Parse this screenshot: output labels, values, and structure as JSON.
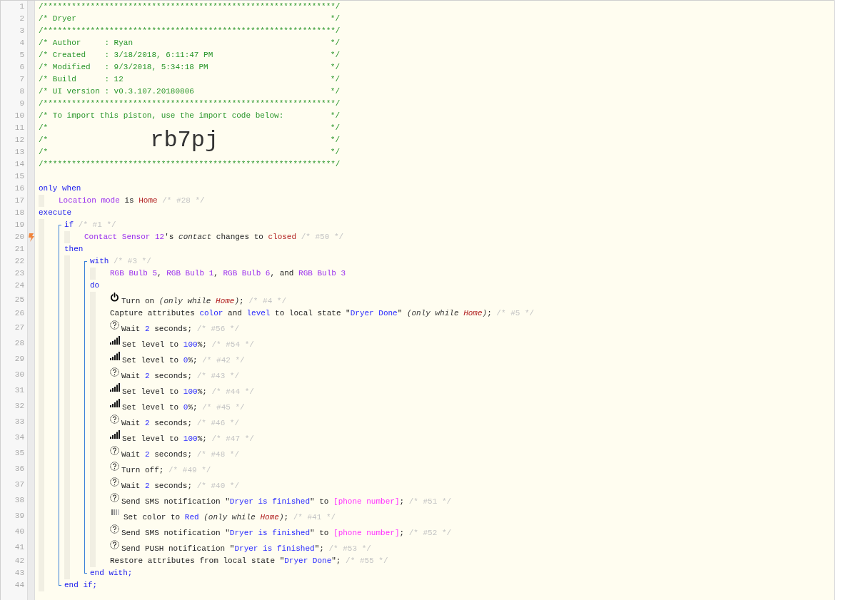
{
  "editor": {
    "lines": [
      {
        "kind": "line",
        "n": "1",
        "tokens": [
          {
            "kind": "h",
            "text": "/**************************************************************/"
          }
        ]
      },
      {
        "kind": "line",
        "n": "2",
        "tokens": [
          {
            "kind": "h",
            "text": "/* Dryer"
          },
          {
            "kind": "he",
            "text": "*/"
          }
        ]
      },
      {
        "kind": "line",
        "n": "3",
        "tokens": [
          {
            "kind": "h",
            "text": "/**************************************************************/"
          }
        ]
      },
      {
        "kind": "line",
        "n": "4",
        "tokens": [
          {
            "kind": "h",
            "text": "/* Author     : Ryan"
          },
          {
            "kind": "he",
            "text": "*/"
          }
        ]
      },
      {
        "kind": "line",
        "n": "5",
        "tokens": [
          {
            "kind": "h",
            "text": "/* Created    : 3/18/2018, 6:11:47 PM"
          },
          {
            "kind": "he",
            "text": "*/"
          }
        ]
      },
      {
        "kind": "line",
        "n": "6",
        "tokens": [
          {
            "kind": "h",
            "text": "/* Modified   : 9/3/2018, 5:34:18 PM"
          },
          {
            "kind": "he",
            "text": "*/"
          }
        ]
      },
      {
        "kind": "line",
        "n": "7",
        "tokens": [
          {
            "kind": "h",
            "text": "/* Build      : 12"
          },
          {
            "kind": "he",
            "text": "*/"
          }
        ]
      },
      {
        "kind": "line",
        "n": "8",
        "tokens": [
          {
            "kind": "h",
            "text": "/* UI version : v0.3.107.20180806"
          },
          {
            "kind": "he",
            "text": "*/"
          }
        ]
      },
      {
        "kind": "line",
        "n": "9",
        "tokens": [
          {
            "kind": "h",
            "text": "/**************************************************************/"
          }
        ]
      },
      {
        "kind": "line",
        "n": "10",
        "tokens": [
          {
            "kind": "h",
            "text": "/* To import this piston, use the import code below:"
          },
          {
            "kind": "he",
            "text": "*/"
          }
        ]
      },
      {
        "kind": "line",
        "n": "11",
        "tokens": [
          {
            "kind": "h",
            "text": "/*"
          },
          {
            "kind": "he",
            "text": "*/"
          }
        ]
      },
      {
        "kind": "line",
        "n": "12",
        "tokens": [
          {
            "kind": "h",
            "text": "/*"
          },
          {
            "kind": "code",
            "text": "rb7pj"
          },
          {
            "kind": "he",
            "text": "*/"
          }
        ]
      },
      {
        "kind": "line",
        "n": "13",
        "tokens": [
          {
            "kind": "h",
            "text": "/*"
          },
          {
            "kind": "he",
            "text": "*/"
          }
        ]
      },
      {
        "kind": "line",
        "n": "14",
        "tokens": [
          {
            "kind": "h",
            "text": "/**************************************************************/"
          }
        ]
      },
      {
        "kind": "line",
        "n": "15"
      },
      {
        "kind": "line",
        "n": "16",
        "tokens": [
          {
            "kind": "kw",
            "text": "only when"
          }
        ],
        "children": [
          {
            "kind": "line",
            "n": "17",
            "tokens": [
              {
                "kind": "dev",
                "text": "Location mode"
              },
              {
                "kind": "txt",
                "text": " is "
              },
              {
                "kind": "val",
                "text": "Home"
              },
              {
                "kind": "cmt",
                "text": " /* #28 */"
              }
            ]
          }
        ]
      },
      {
        "kind": "line",
        "n": "18",
        "tokens": [
          {
            "kind": "kw",
            "text": "execute"
          }
        ],
        "children": [
          {
            "kind": "block",
            "parts": [
              {
                "kind": "line",
                "n": "19",
                "tokens": [
                  {
                    "kind": "kw",
                    "text": "if"
                  },
                  {
                    "kind": "cmt",
                    "text": " /* #1 */"
                  }
                ],
                "children": [
                  {
                    "kind": "line",
                    "n": "20",
                    "trigger": true,
                    "tokens": [
                      {
                        "kind": "dev",
                        "text": "Contact Sensor 12"
                      },
                      {
                        "kind": "txt",
                        "text": "'s "
                      },
                      {
                        "kind": "it",
                        "text": "contact"
                      },
                      {
                        "kind": "txt",
                        "text": " changes to "
                      },
                      {
                        "kind": "val",
                        "text": "closed"
                      },
                      {
                        "kind": "cmt",
                        "text": " /* #50 */"
                      }
                    ]
                  }
                ]
              },
              {
                "kind": "line",
                "n": "21",
                "tokens": [
                  {
                    "kind": "kw",
                    "text": "then"
                  }
                ],
                "children": [
                  {
                    "kind": "block",
                    "parts": [
                      {
                        "kind": "line",
                        "n": "22",
                        "tokens": [
                          {
                            "kind": "kw",
                            "text": "with"
                          },
                          {
                            "kind": "cmt",
                            "text": " /* #3 */"
                          }
                        ],
                        "children": [
                          {
                            "kind": "line",
                            "n": "23",
                            "tokens": [
                              {
                                "kind": "dev",
                                "text": "RGB Bulb 5"
                              },
                              {
                                "kind": "txt",
                                "text": ", "
                              },
                              {
                                "kind": "dev",
                                "text": "RGB Bulb 1"
                              },
                              {
                                "kind": "txt",
                                "text": ", "
                              },
                              {
                                "kind": "dev",
                                "text": "RGB Bulb 6"
                              },
                              {
                                "kind": "txt",
                                "text": ", and "
                              },
                              {
                                "kind": "dev",
                                "text": "RGB Bulb 3"
                              }
                            ]
                          }
                        ]
                      },
                      {
                        "kind": "line",
                        "n": "24",
                        "tokens": [
                          {
                            "kind": "kw",
                            "text": "do"
                          }
                        ],
                        "children": [
                          {
                            "kind": "power",
                            "n": "25",
                            "tokens": [
                              {
                                "kind": "txt",
                                "text": "Turn on "
                              },
                              {
                                "kind": "it",
                                "text": "(only while "
                              },
                              {
                                "kind": "ival",
                                "text": "Home"
                              },
                              {
                                "kind": "it",
                                "text": ")"
                              },
                              {
                                "kind": "txt",
                                "text": "; "
                              },
                              {
                                "kind": "cmt",
                                "text": "/* #4 */"
                              }
                            ]
                          },
                          {
                            "kind": "line",
                            "n": "26",
                            "tokens": [
                              {
                                "kind": "txt",
                                "text": "Capture attributes "
                              },
                              {
                                "kind": "num",
                                "text": "color"
                              },
                              {
                                "kind": "txt",
                                "text": " and "
                              },
                              {
                                "kind": "num",
                                "text": "level"
                              },
                              {
                                "kind": "txt",
                                "text": " to local state \""
                              },
                              {
                                "kind": "num",
                                "text": "Dryer Done"
                              },
                              {
                                "kind": "txt",
                                "text": "\" "
                              },
                              {
                                "kind": "it",
                                "text": "(only while "
                              },
                              {
                                "kind": "ival",
                                "text": "Home"
                              },
                              {
                                "kind": "it",
                                "text": ")"
                              },
                              {
                                "kind": "txt",
                                "text": "; "
                              },
                              {
                                "kind": "cmt",
                                "text": "/* #5 */"
                              }
                            ]
                          },
                          {
                            "kind": "help",
                            "n": "27",
                            "tokens": [
                              {
                                "kind": "txt",
                                "text": "Wait "
                              },
                              {
                                "kind": "num",
                                "text": "2"
                              },
                              {
                                "kind": "txt",
                                "text": " seconds; "
                              },
                              {
                                "kind": "cmt",
                                "text": "/* #56 */"
                              }
                            ]
                          },
                          {
                            "kind": "level",
                            "n": "28",
                            "tokens": [
                              {
                                "kind": "txt",
                                "text": "Set level to "
                              },
                              {
                                "kind": "num",
                                "text": "100"
                              },
                              {
                                "kind": "txt",
                                "text": "%; "
                              },
                              {
                                "kind": "cmt",
                                "text": "/* #54 */"
                              }
                            ]
                          },
                          {
                            "kind": "level",
                            "n": "29",
                            "tokens": [
                              {
                                "kind": "txt",
                                "text": "Set level to "
                              },
                              {
                                "kind": "num",
                                "text": "0"
                              },
                              {
                                "kind": "txt",
                                "text": "%; "
                              },
                              {
                                "kind": "cmt",
                                "text": "/* #42 */"
                              }
                            ]
                          },
                          {
                            "kind": "help",
                            "n": "30",
                            "tokens": [
                              {
                                "kind": "txt",
                                "text": "Wait "
                              },
                              {
                                "kind": "num",
                                "text": "2"
                              },
                              {
                                "kind": "txt",
                                "text": " seconds; "
                              },
                              {
                                "kind": "cmt",
                                "text": "/* #43 */"
                              }
                            ]
                          },
                          {
                            "kind": "level",
                            "n": "31",
                            "tokens": [
                              {
                                "kind": "txt",
                                "text": "Set level to "
                              },
                              {
                                "kind": "num",
                                "text": "100"
                              },
                              {
                                "kind": "txt",
                                "text": "%; "
                              },
                              {
                                "kind": "cmt",
                                "text": "/* #44 */"
                              }
                            ]
                          },
                          {
                            "kind": "level",
                            "n": "32",
                            "tokens": [
                              {
                                "kind": "txt",
                                "text": "Set level to "
                              },
                              {
                                "kind": "num",
                                "text": "0"
                              },
                              {
                                "kind": "txt",
                                "text": "%; "
                              },
                              {
                                "kind": "cmt",
                                "text": "/* #45 */"
                              }
                            ]
                          },
                          {
                            "kind": "help",
                            "n": "33",
                            "tokens": [
                              {
                                "kind": "txt",
                                "text": "Wait "
                              },
                              {
                                "kind": "num",
                                "text": "2"
                              },
                              {
                                "kind": "txt",
                                "text": " seconds; "
                              },
                              {
                                "kind": "cmt",
                                "text": "/* #46 */"
                              }
                            ]
                          },
                          {
                            "kind": "level",
                            "n": "34",
                            "tokens": [
                              {
                                "kind": "txt",
                                "text": "Set level to "
                              },
                              {
                                "kind": "num",
                                "text": "100"
                              },
                              {
                                "kind": "txt",
                                "text": "%; "
                              },
                              {
                                "kind": "cmt",
                                "text": "/* #47 */"
                              }
                            ]
                          },
                          {
                            "kind": "help",
                            "n": "35",
                            "tokens": [
                              {
                                "kind": "txt",
                                "text": "Wait "
                              },
                              {
                                "kind": "num",
                                "text": "2"
                              },
                              {
                                "kind": "txt",
                                "text": " seconds; "
                              },
                              {
                                "kind": "cmt",
                                "text": "/* #48 */"
                              }
                            ]
                          },
                          {
                            "kind": "help",
                            "n": "36",
                            "tokens": [
                              {
                                "kind": "txt",
                                "text": "Turn off; "
                              },
                              {
                                "kind": "cmt",
                                "text": "/* #49 */"
                              }
                            ]
                          },
                          {
                            "kind": "help",
                            "n": "37",
                            "tokens": [
                              {
                                "kind": "txt",
                                "text": "Wait "
                              },
                              {
                                "kind": "num",
                                "text": "2"
                              },
                              {
                                "kind": "txt",
                                "text": " seconds; "
                              },
                              {
                                "kind": "cmt",
                                "text": "/* #40 */"
                              }
                            ]
                          },
                          {
                            "kind": "help",
                            "n": "38",
                            "tokens": [
                              {
                                "kind": "txt",
                                "text": "Send SMS notification \""
                              },
                              {
                                "kind": "num",
                                "text": "Dryer is finished"
                              },
                              {
                                "kind": "txt",
                                "text": "\" to "
                              },
                              {
                                "kind": "ph",
                                "text": "[phone number]"
                              },
                              {
                                "kind": "txt",
                                "text": "; "
                              },
                              {
                                "kind": "cmt",
                                "text": "/* #51 */"
                              }
                            ]
                          },
                          {
                            "kind": "color",
                            "n": "39",
                            "tokens": [
                              {
                                "kind": "txt",
                                "text": "Set color to "
                              },
                              {
                                "kind": "num",
                                "text": "Red"
                              },
                              {
                                "kind": "it",
                                "text": " (only while "
                              },
                              {
                                "kind": "ival",
                                "text": "Home"
                              },
                              {
                                "kind": "it",
                                "text": ")"
                              },
                              {
                                "kind": "txt",
                                "text": "; "
                              },
                              {
                                "kind": "cmt",
                                "text": "/* #41 */"
                              }
                            ]
                          },
                          {
                            "kind": "help",
                            "n": "40",
                            "tokens": [
                              {
                                "kind": "txt",
                                "text": "Send SMS notification \""
                              },
                              {
                                "kind": "num",
                                "text": "Dryer is finished"
                              },
                              {
                                "kind": "txt",
                                "text": "\" to "
                              },
                              {
                                "kind": "ph",
                                "text": "[phone number]"
                              },
                              {
                                "kind": "txt",
                                "text": "; "
                              },
                              {
                                "kind": "cmt",
                                "text": "/* #52 */"
                              }
                            ]
                          },
                          {
                            "kind": "help",
                            "n": "41",
                            "tokens": [
                              {
                                "kind": "txt",
                                "text": "Send PUSH notification \""
                              },
                              {
                                "kind": "num",
                                "text": "Dryer is finished"
                              },
                              {
                                "kind": "txt",
                                "text": "\"; "
                              },
                              {
                                "kind": "cmt",
                                "text": "/* #53 */"
                              }
                            ]
                          },
                          {
                            "kind": "line",
                            "n": "42",
                            "tokens": [
                              {
                                "kind": "txt",
                                "text": "Restore attributes from local state \""
                              },
                              {
                                "kind": "num",
                                "text": "Dryer Done"
                              },
                              {
                                "kind": "txt",
                                "text": "\"; "
                              },
                              {
                                "kind": "cmt",
                                "text": "/* #55 */"
                              }
                            ]
                          }
                        ]
                      },
                      {
                        "kind": "line",
                        "n": "43",
                        "tokens": [
                          {
                            "kind": "kw",
                            "text": "end with;"
                          }
                        ]
                      }
                    ]
                  }
                ]
              },
              {
                "kind": "line",
                "n": "44",
                "tokens": [
                  {
                    "kind": "kw",
                    "text": "end if;"
                  }
                ]
              }
            ]
          }
        ]
      }
    ]
  }
}
